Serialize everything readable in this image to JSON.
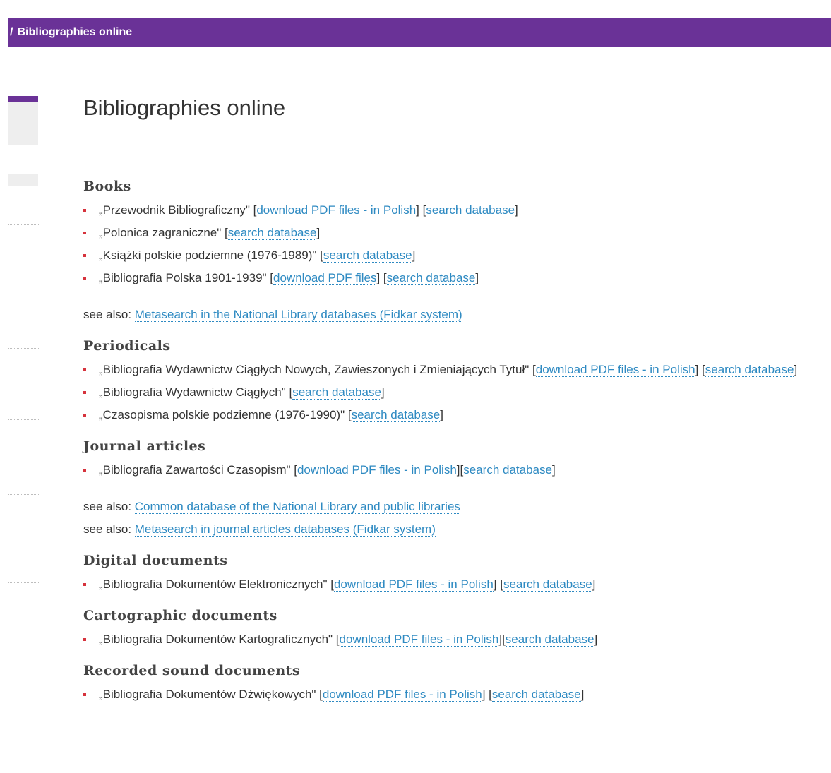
{
  "breadcrumb": {
    "separator": "/",
    "label": "Bibliographies online"
  },
  "page_title": "Bibliographies online",
  "sections": {
    "books": {
      "heading": "Books",
      "items": [
        {
          "text": "„Przewodnik Bibliograficzny\" [",
          "link1": "download PDF files - in Polish",
          "mid": "] [",
          "link2": "search database",
          "end": "]"
        },
        {
          "text": "„Polonica zagraniczne\" [",
          "link1": "search database",
          "end": "]"
        },
        {
          "text": "„Książki polskie podziemne (1976-1989)\" [",
          "link1": "search database",
          "end": "]"
        },
        {
          "text": "„Bibliografia Polska 1901-1939\" [",
          "link1": "download PDF files",
          "mid": "] [",
          "link2": "search database",
          "end": "]"
        }
      ],
      "see_also": [
        {
          "prefix": "see also: ",
          "link": "Metasearch in the National Library databases (Fidkar system)"
        }
      ]
    },
    "periodicals": {
      "heading": "Periodicals",
      "items": [
        {
          "text": "„Bibliografia Wydawnictw Ciągłych Nowych, Zawieszonych i Zmieniających Tytuł\" [",
          "link1": "download PDF files - in Polish",
          "mid": "] [",
          "link2": "search database",
          "end": "]"
        },
        {
          "text": "„Bibliografia Wydawnictw Ciągłych\" [",
          "link1": "search database",
          "end": "]"
        },
        {
          "text": "„Czasopisma polskie podziemne (1976-1990)\" [",
          "link1": "search database",
          "end": "]"
        }
      ]
    },
    "journal_articles": {
      "heading": "Journal articles",
      "items": [
        {
          "text": "„Bibliografia Zawartości Czasopism\" [",
          "link1": "download PDF files - in Polish",
          "mid": "][",
          "link2": "search database",
          "end": "]"
        }
      ],
      "see_also": [
        {
          "prefix": "see also: ",
          "link": "Common database of the National Library and public libraries"
        },
        {
          "prefix": "see also: ",
          "link": "Metasearch in journal articles databases (Fidkar system)"
        }
      ]
    },
    "digital": {
      "heading": "Digital documents",
      "items": [
        {
          "text": "„Bibliografia Dokumentów Elektronicznych\" [",
          "link1": "download PDF files - in Polish",
          "mid": "] [",
          "link2": "search database",
          "end": "]"
        }
      ]
    },
    "cartographic": {
      "heading": "Cartographic documents",
      "items": [
        {
          "text": "„Bibliografia Dokumentów Kartograficznych\" [",
          "link1": "download PDF files - in Polish",
          "mid": "][",
          "link2": "search database",
          "end": "]"
        }
      ]
    },
    "sound": {
      "heading": "Recorded sound documents",
      "items": [
        {
          "text": "„Bibliografia Dokumentów Dźwiękowych\" [",
          "link1": "download PDF files - in Polish",
          "mid": "] [",
          "link2": "search database",
          "end": "]"
        }
      ]
    }
  },
  "colors": {
    "brand_purple": "#6a3297",
    "link": "#2e8ac2",
    "bullet": "#d6323c"
  }
}
